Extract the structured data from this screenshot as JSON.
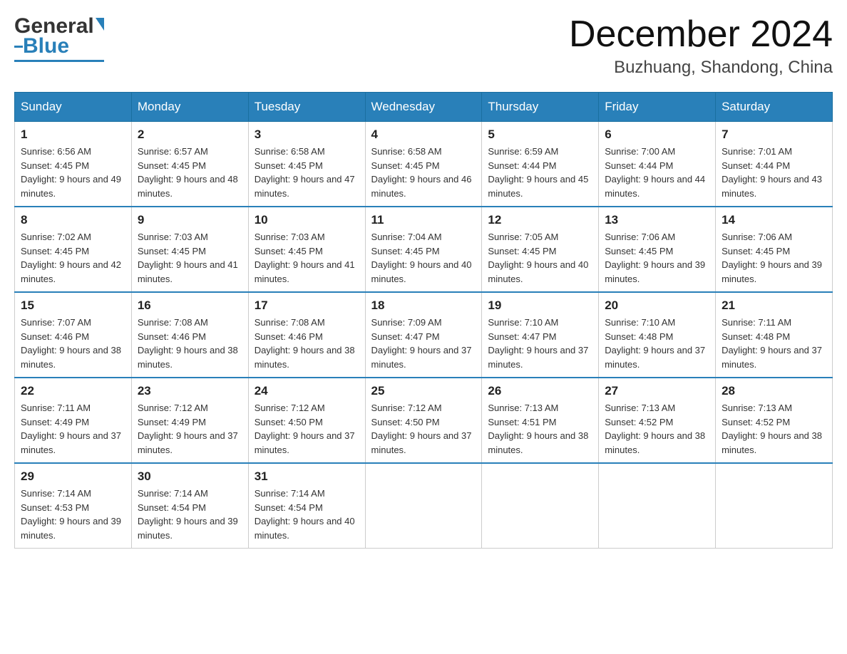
{
  "header": {
    "logo_general": "General",
    "logo_blue": "Blue",
    "month_title": "December 2024",
    "location": "Buzhuang, Shandong, China"
  },
  "days_of_week": [
    "Sunday",
    "Monday",
    "Tuesday",
    "Wednesday",
    "Thursday",
    "Friday",
    "Saturday"
  ],
  "weeks": [
    [
      {
        "day": "1",
        "sunrise": "Sunrise: 6:56 AM",
        "sunset": "Sunset: 4:45 PM",
        "daylight": "Daylight: 9 hours and 49 minutes."
      },
      {
        "day": "2",
        "sunrise": "Sunrise: 6:57 AM",
        "sunset": "Sunset: 4:45 PM",
        "daylight": "Daylight: 9 hours and 48 minutes."
      },
      {
        "day": "3",
        "sunrise": "Sunrise: 6:58 AM",
        "sunset": "Sunset: 4:45 PM",
        "daylight": "Daylight: 9 hours and 47 minutes."
      },
      {
        "day": "4",
        "sunrise": "Sunrise: 6:58 AM",
        "sunset": "Sunset: 4:45 PM",
        "daylight": "Daylight: 9 hours and 46 minutes."
      },
      {
        "day": "5",
        "sunrise": "Sunrise: 6:59 AM",
        "sunset": "Sunset: 4:44 PM",
        "daylight": "Daylight: 9 hours and 45 minutes."
      },
      {
        "day": "6",
        "sunrise": "Sunrise: 7:00 AM",
        "sunset": "Sunset: 4:44 PM",
        "daylight": "Daylight: 9 hours and 44 minutes."
      },
      {
        "day": "7",
        "sunrise": "Sunrise: 7:01 AM",
        "sunset": "Sunset: 4:44 PM",
        "daylight": "Daylight: 9 hours and 43 minutes."
      }
    ],
    [
      {
        "day": "8",
        "sunrise": "Sunrise: 7:02 AM",
        "sunset": "Sunset: 4:45 PM",
        "daylight": "Daylight: 9 hours and 42 minutes."
      },
      {
        "day": "9",
        "sunrise": "Sunrise: 7:03 AM",
        "sunset": "Sunset: 4:45 PM",
        "daylight": "Daylight: 9 hours and 41 minutes."
      },
      {
        "day": "10",
        "sunrise": "Sunrise: 7:03 AM",
        "sunset": "Sunset: 4:45 PM",
        "daylight": "Daylight: 9 hours and 41 minutes."
      },
      {
        "day": "11",
        "sunrise": "Sunrise: 7:04 AM",
        "sunset": "Sunset: 4:45 PM",
        "daylight": "Daylight: 9 hours and 40 minutes."
      },
      {
        "day": "12",
        "sunrise": "Sunrise: 7:05 AM",
        "sunset": "Sunset: 4:45 PM",
        "daylight": "Daylight: 9 hours and 40 minutes."
      },
      {
        "day": "13",
        "sunrise": "Sunrise: 7:06 AM",
        "sunset": "Sunset: 4:45 PM",
        "daylight": "Daylight: 9 hours and 39 minutes."
      },
      {
        "day": "14",
        "sunrise": "Sunrise: 7:06 AM",
        "sunset": "Sunset: 4:45 PM",
        "daylight": "Daylight: 9 hours and 39 minutes."
      }
    ],
    [
      {
        "day": "15",
        "sunrise": "Sunrise: 7:07 AM",
        "sunset": "Sunset: 4:46 PM",
        "daylight": "Daylight: 9 hours and 38 minutes."
      },
      {
        "day": "16",
        "sunrise": "Sunrise: 7:08 AM",
        "sunset": "Sunset: 4:46 PM",
        "daylight": "Daylight: 9 hours and 38 minutes."
      },
      {
        "day": "17",
        "sunrise": "Sunrise: 7:08 AM",
        "sunset": "Sunset: 4:46 PM",
        "daylight": "Daylight: 9 hours and 38 minutes."
      },
      {
        "day": "18",
        "sunrise": "Sunrise: 7:09 AM",
        "sunset": "Sunset: 4:47 PM",
        "daylight": "Daylight: 9 hours and 37 minutes."
      },
      {
        "day": "19",
        "sunrise": "Sunrise: 7:10 AM",
        "sunset": "Sunset: 4:47 PM",
        "daylight": "Daylight: 9 hours and 37 minutes."
      },
      {
        "day": "20",
        "sunrise": "Sunrise: 7:10 AM",
        "sunset": "Sunset: 4:48 PM",
        "daylight": "Daylight: 9 hours and 37 minutes."
      },
      {
        "day": "21",
        "sunrise": "Sunrise: 7:11 AM",
        "sunset": "Sunset: 4:48 PM",
        "daylight": "Daylight: 9 hours and 37 minutes."
      }
    ],
    [
      {
        "day": "22",
        "sunrise": "Sunrise: 7:11 AM",
        "sunset": "Sunset: 4:49 PM",
        "daylight": "Daylight: 9 hours and 37 minutes."
      },
      {
        "day": "23",
        "sunrise": "Sunrise: 7:12 AM",
        "sunset": "Sunset: 4:49 PM",
        "daylight": "Daylight: 9 hours and 37 minutes."
      },
      {
        "day": "24",
        "sunrise": "Sunrise: 7:12 AM",
        "sunset": "Sunset: 4:50 PM",
        "daylight": "Daylight: 9 hours and 37 minutes."
      },
      {
        "day": "25",
        "sunrise": "Sunrise: 7:12 AM",
        "sunset": "Sunset: 4:50 PM",
        "daylight": "Daylight: 9 hours and 37 minutes."
      },
      {
        "day": "26",
        "sunrise": "Sunrise: 7:13 AM",
        "sunset": "Sunset: 4:51 PM",
        "daylight": "Daylight: 9 hours and 38 minutes."
      },
      {
        "day": "27",
        "sunrise": "Sunrise: 7:13 AM",
        "sunset": "Sunset: 4:52 PM",
        "daylight": "Daylight: 9 hours and 38 minutes."
      },
      {
        "day": "28",
        "sunrise": "Sunrise: 7:13 AM",
        "sunset": "Sunset: 4:52 PM",
        "daylight": "Daylight: 9 hours and 38 minutes."
      }
    ],
    [
      {
        "day": "29",
        "sunrise": "Sunrise: 7:14 AM",
        "sunset": "Sunset: 4:53 PM",
        "daylight": "Daylight: 9 hours and 39 minutes."
      },
      {
        "day": "30",
        "sunrise": "Sunrise: 7:14 AM",
        "sunset": "Sunset: 4:54 PM",
        "daylight": "Daylight: 9 hours and 39 minutes."
      },
      {
        "day": "31",
        "sunrise": "Sunrise: 7:14 AM",
        "sunset": "Sunset: 4:54 PM",
        "daylight": "Daylight: 9 hours and 40 minutes."
      },
      null,
      null,
      null,
      null
    ]
  ]
}
